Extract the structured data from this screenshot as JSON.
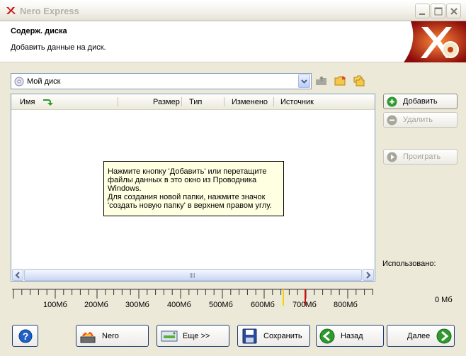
{
  "window": {
    "title": "Nero Express"
  },
  "header": {
    "title": "Содерж. диска",
    "subtitle": "Добавить данные на диск."
  },
  "disc_select": {
    "value": "Мой диск"
  },
  "list": {
    "columns": [
      "Имя",
      "Размер",
      "Тип",
      "Изменено",
      "Источник"
    ],
    "hint_lines": [
      "Нажмите кнопку 'Добавить' или перетащите",
      "файлы данных в это окно из Проводника",
      "Windows.",
      "Для создания новой папки, нажмите значок",
      "'создать новую папку' в верхнем правом углу."
    ]
  },
  "side_buttons": {
    "add": "Добавить",
    "delete": "Удалить",
    "play": "Проиграть"
  },
  "usage": {
    "label": "Использовано:",
    "value": "0 Мб"
  },
  "ruler": {
    "labels": [
      "100Мб",
      "200Мб",
      "300Мб",
      "400Мб",
      "500Мб",
      "600Мб",
      "700Мб",
      "800Мб"
    ]
  },
  "bottom_buttons": {
    "nero": "Nero",
    "more": "Еще >>",
    "save": "Сохранить",
    "back": "Назад",
    "next": "Далее"
  },
  "colors": {
    "accent_green": "#2e9a2e",
    "limit_red": "#d01010",
    "limit_yellow": "#f2d200",
    "help_blue": "#1e5fc8"
  }
}
